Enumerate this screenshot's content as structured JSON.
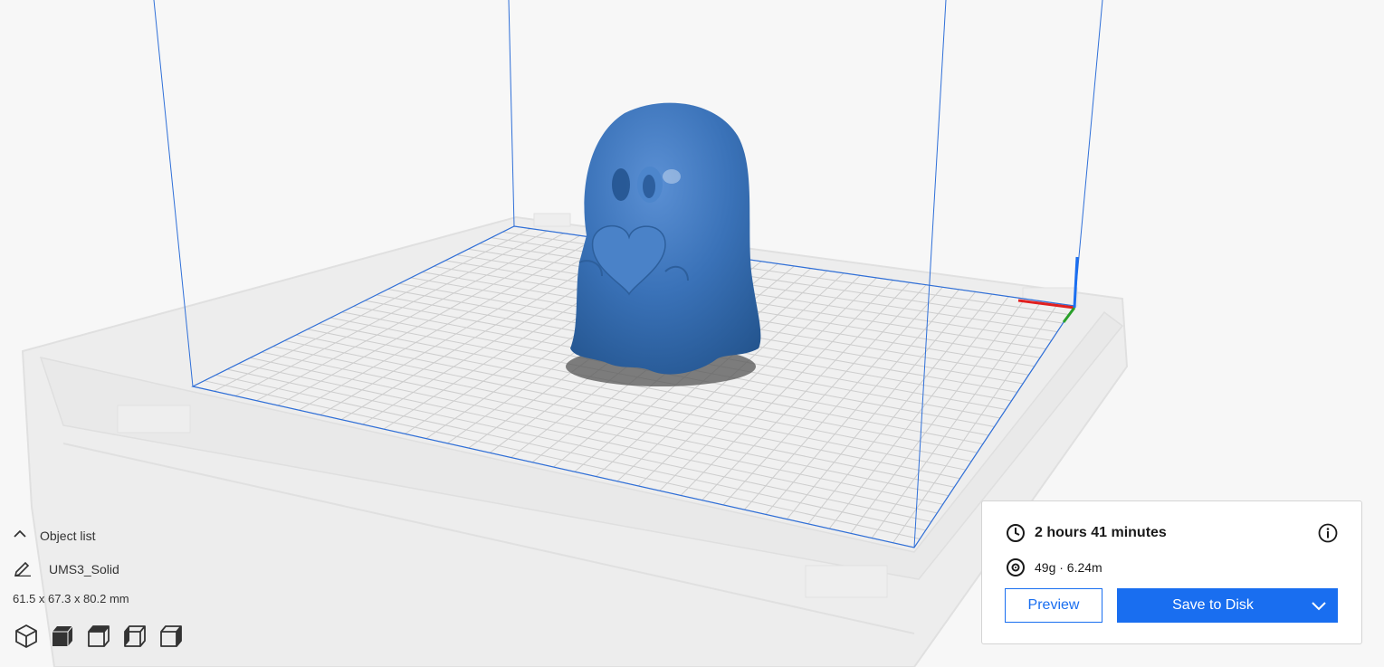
{
  "viewport": {
    "model_name": "ghost model",
    "model_color": "#3a72b8",
    "axis_colors": {
      "x": "#e02020",
      "y": "#2aa02a",
      "z": "#1a6ef0"
    },
    "volume_outline_color": "#1a6ef0"
  },
  "object_list": {
    "header_label": "Object list",
    "header_icon": "chevron-up-icon",
    "item_icon": "pencil-icon",
    "item_name": "UMS3_Solid",
    "dimensions": "61.5 x 67.3 x 80.2 mm"
  },
  "view_buttons": [
    {
      "name": "view-3d-button",
      "icon": "cube-3d-icon"
    },
    {
      "name": "view-front-button",
      "icon": "cube-front-icon"
    },
    {
      "name": "view-top-button",
      "icon": "cube-top-icon"
    },
    {
      "name": "view-left-button",
      "icon": "cube-left-icon"
    },
    {
      "name": "view-right-button",
      "icon": "cube-right-icon"
    }
  ],
  "print_summary": {
    "time_icon": "clock-icon",
    "print_time": "2 hours 41 minutes",
    "info_icon": "info-icon",
    "material_icon": "filament-spool-icon",
    "material": "49g · 6.24m",
    "preview_label": "Preview",
    "save_label": "Save to Disk",
    "save_dropdown_icon": "chevron-down-icon",
    "accent_color": "#196ef0"
  }
}
